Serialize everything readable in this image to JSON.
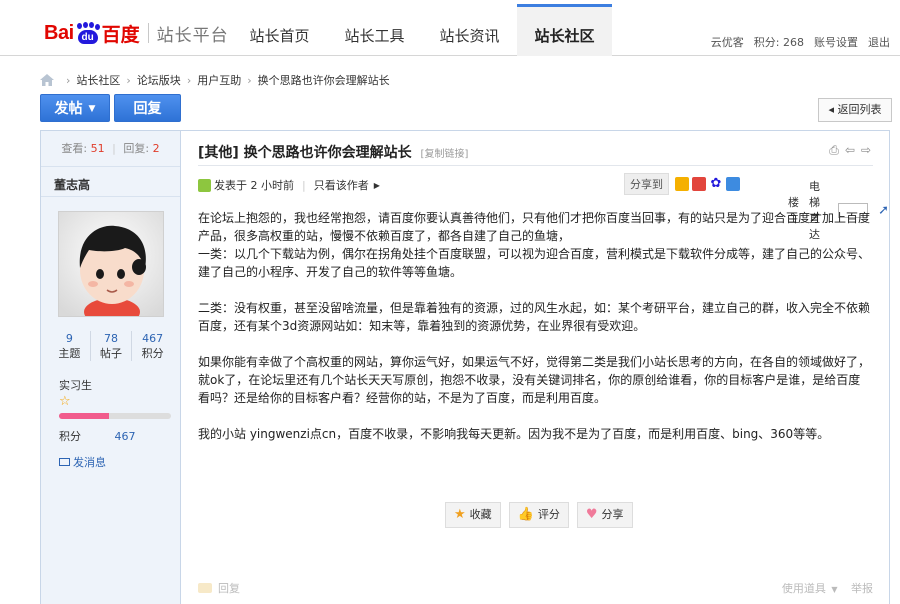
{
  "header": {
    "logo_bai": "Bai",
    "logo_du": "du",
    "logo_cn": "百度",
    "platform": "站长平台",
    "nav": [
      "站长首页",
      "站长工具",
      "站长资讯",
      "站长社区"
    ],
    "active_nav": "站长社区",
    "user": "云优客",
    "points": "积分: 268",
    "account": "账号设置",
    "logout": "退出"
  },
  "breadcrumb": [
    "站长社区",
    "论坛版块",
    "用户互助",
    "换个思路也许你会理解站长"
  ],
  "buttons": {
    "post": "发帖",
    "reply": "回复",
    "back": "返回列表"
  },
  "sidebar": {
    "views_label": "查看:",
    "views": "51",
    "replies_label": "回复:",
    "replies": "2",
    "username": "董志高",
    "counts": [
      {
        "num": "9",
        "label": "主题"
      },
      {
        "num": "78",
        "label": "帖子"
      },
      {
        "num": "467",
        "label": "积分"
      }
    ],
    "rank": "实习生",
    "rank_progress": 0.45,
    "points_label": "积分",
    "points_value": "467",
    "message": "发消息"
  },
  "post": {
    "category": "[其他]",
    "title": "换个思路也许你会理解站长",
    "copy_link": "[复制链接]",
    "posted": "发表于 2 小时前",
    "author_only": "只看该作者",
    "share_label": "分享到",
    "floor": "楼主",
    "elevator": "电梯直达",
    "paragraphs": [
      "在论坛上抱怨的，我也经常抱怨，请百度你要认真善待他们，只有他们才把你百度当回事，有的站只是为了迎合百度才加上百度产品，很多高权重的站，慢慢不依赖百度了，都各自建了自己的鱼塘，\n一类：以几个下载站为例，偶尔在拐角处挂个百度联盟，可以视为迎合百度，营利模式是下载软件分成等，建了自己的公众号、建了自己的小程序、开发了自己的软件等等鱼塘。",
      "二类：没有权重，甚至没留啥流量，但是靠着独有的资源，过的风生水起，如：某个考研平台，建立自己的群，收入完全不依赖百度，还有某个3d资源网站如：知末等，靠着独到的资源优势，在业界很有受欢迎。",
      "如果你能有幸做了个高权重的网站，算你运气好，如果运气不好，觉得第二类是我们小站长思考的方向，在各自的领域做好了，就ok了，在论坛里还有几个站长天天写原创，抱怨不收录，没有关键词排名，你的原创给谁看，你的目标客户是谁，是给百度看吗？还是给你的目标客户看？经营你的站，不是为了百度，而是利用百度。",
      "我的小站  yingwenzi点cn，百度不收录，不影响我每天更新。因为我不是为了百度，而是利用百度、bing、360等等。"
    ],
    "actions": [
      "收藏",
      "评分",
      "分享"
    ],
    "reply_link": "回复",
    "use_tools": "使用道具",
    "report": "举报"
  }
}
